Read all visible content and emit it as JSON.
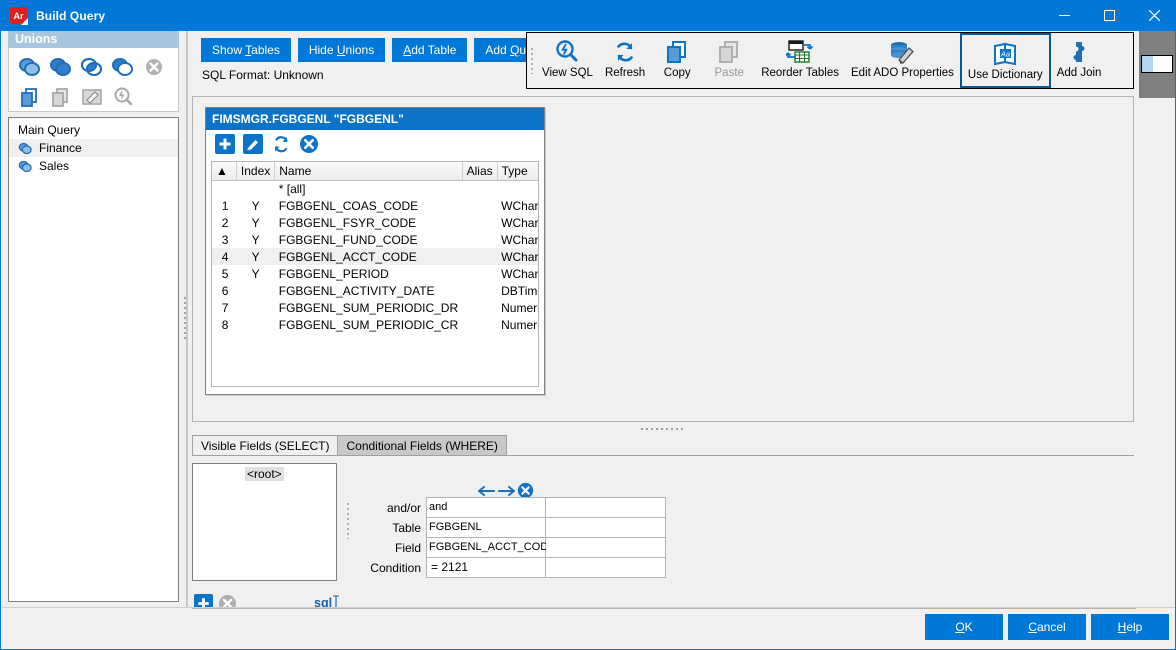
{
  "window": {
    "title": "Build Query",
    "app_icon": "Ar",
    "minimize": "minimize-icon",
    "maximize": "maximize-icon",
    "close": "close-icon"
  },
  "sidebar": {
    "header": "Unions",
    "union_ops": [
      {
        "name": "union-all-icon",
        "label": "Union All",
        "enabled": true
      },
      {
        "name": "union-icon",
        "label": "Union",
        "enabled": true
      },
      {
        "name": "intersect-icon",
        "label": "Intersect",
        "enabled": true
      },
      {
        "name": "except-icon",
        "label": "Except",
        "enabled": true
      },
      {
        "name": "remove-union-icon",
        "label": "Remove Union",
        "enabled": false
      }
    ],
    "row2_ops": [
      {
        "name": "copy-query-icon",
        "label": "Copy Query",
        "enabled": true
      },
      {
        "name": "paste-query-icon",
        "label": "Paste Query",
        "enabled": false
      },
      {
        "name": "edit-query-icon",
        "label": "Edit Query",
        "enabled": false
      },
      {
        "name": "view-sql-icon",
        "label": "View SQL",
        "enabled": false
      }
    ],
    "tree_root": "Main Query",
    "items": [
      {
        "label": "Finance",
        "selected": true
      },
      {
        "label": "Sales",
        "selected": false
      }
    ]
  },
  "toolbar": {
    "buttons": [
      {
        "label": "Show Tables",
        "accel": "T",
        "pre": "Show ",
        "post": "ables"
      },
      {
        "label": "Hide Unions",
        "accel": "U",
        "pre": "Hide ",
        "post": "nions"
      },
      {
        "label": "Add Table",
        "accel": "A",
        "pre": "",
        "post": "dd Table"
      },
      {
        "label": "Add Query",
        "accel": "Q",
        "pre": "Add ",
        "post": "uery"
      }
    ],
    "sql_format": "SQL Format: Unknown"
  },
  "ribbon": {
    "items": [
      {
        "label": "View SQL",
        "icon": "view-sql-icon",
        "enabled": true,
        "selected": false
      },
      {
        "label": "Refresh",
        "icon": "refresh-icon",
        "enabled": true,
        "selected": false
      },
      {
        "label": "Copy",
        "icon": "copy-icon",
        "enabled": true,
        "selected": false
      },
      {
        "label": "Paste",
        "icon": "paste-icon",
        "enabled": false,
        "selected": false
      },
      {
        "label": "Reorder Tables",
        "icon": "reorder-tables-icon",
        "enabled": true,
        "selected": false
      },
      {
        "label": "Edit ADO Properties",
        "icon": "edit-ado-properties-icon",
        "enabled": true,
        "selected": false
      },
      {
        "label": "Use Dictionary",
        "icon": "use-dictionary-icon",
        "enabled": true,
        "selected": true
      },
      {
        "label": "Add Join",
        "icon": "add-join-icon",
        "enabled": true,
        "selected": false
      }
    ]
  },
  "table_card": {
    "title": "FIMSMGR.FGBGENL \"FGBGENL\"",
    "tools": [
      {
        "name": "add-field-icon",
        "label": "Add"
      },
      {
        "name": "edit-field-icon",
        "label": "Edit"
      },
      {
        "name": "refresh-fields-icon",
        "label": "Refresh"
      },
      {
        "name": "delete-table-icon",
        "label": "Delete"
      }
    ],
    "columns": [
      "",
      "Index",
      "Name",
      "Alias",
      "Type"
    ],
    "rows": [
      {
        "num": "",
        "index": "",
        "name": "* [all]",
        "alias": "",
        "type": "",
        "highlight": false
      },
      {
        "num": "1",
        "index": "Y",
        "name": "FGBGENL_COAS_CODE",
        "alias": "",
        "type": "WChar",
        "highlight": false
      },
      {
        "num": "2",
        "index": "Y",
        "name": "FGBGENL_FSYR_CODE",
        "alias": "",
        "type": "WChar",
        "highlight": false
      },
      {
        "num": "3",
        "index": "Y",
        "name": "FGBGENL_FUND_CODE",
        "alias": "",
        "type": "WChar",
        "highlight": false
      },
      {
        "num": "4",
        "index": "Y",
        "name": "FGBGENL_ACCT_CODE",
        "alias": "",
        "type": "WChar",
        "highlight": true
      },
      {
        "num": "5",
        "index": "Y",
        "name": "FGBGENL_PERIOD",
        "alias": "",
        "type": "WChar",
        "highlight": false
      },
      {
        "num": "6",
        "index": "",
        "name": "FGBGENL_ACTIVITY_DATE",
        "alias": "",
        "type": "DBTime...",
        "highlight": false
      },
      {
        "num": "7",
        "index": "",
        "name": "FGBGENL_SUM_PERIODIC_DR",
        "alias": "",
        "type": "Numeric",
        "highlight": false
      },
      {
        "num": "8",
        "index": "",
        "name": "FGBGENL_SUM_PERIODIC_CR",
        "alias": "",
        "type": "Numeric",
        "highlight": false
      }
    ]
  },
  "bottom": {
    "tabs": [
      {
        "label": "Visible Fields (SELECT)",
        "active": false
      },
      {
        "label": "Conditional Fields (WHERE)",
        "active": true
      }
    ],
    "tree_root_label": "<root>",
    "tree_tools": [
      {
        "name": "add-condition-icon",
        "label": "Add",
        "enabled": true
      },
      {
        "name": "remove-condition-icon",
        "label": "Remove",
        "enabled": false
      }
    ],
    "sql_label": "sql",
    "nav": [
      {
        "name": "move-left-icon",
        "label": "Move Left"
      },
      {
        "name": "move-right-icon",
        "label": "Move Right"
      },
      {
        "name": "delete-condition-icon",
        "label": "Delete"
      }
    ],
    "condition_rows": [
      {
        "label": "and/or",
        "value": "and",
        "value2": ""
      },
      {
        "label": "Table",
        "value": "FGBGENL",
        "value2": ""
      },
      {
        "label": "Field",
        "value": "FGBGENL_ACCT_CODE",
        "value2": ""
      },
      {
        "label": "Condition",
        "value": "= 2121",
        "value2": ""
      }
    ]
  },
  "footer": {
    "ok": {
      "pre": "",
      "accel": "O",
      "post": "K"
    },
    "cancel": {
      "pre": "",
      "accel": "C",
      "post": "ancel"
    },
    "help": {
      "pre": "",
      "accel": "H",
      "post": "elp"
    }
  },
  "colors": {
    "accent": "#0078d7",
    "title_bar": "#0078d7",
    "unions_header": "#a8c6de",
    "card_title": "#0c73c8",
    "selected_border": "#005a9e"
  }
}
